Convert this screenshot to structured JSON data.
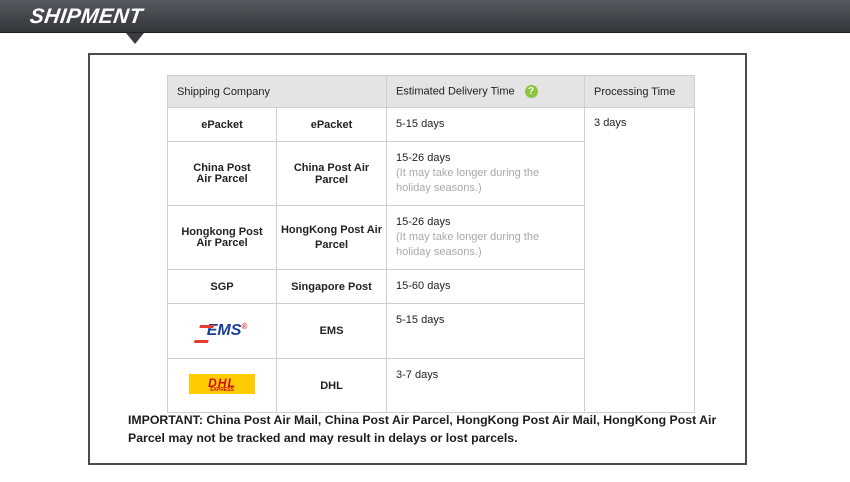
{
  "header": {
    "title": "SHIPMENT"
  },
  "table": {
    "headers": {
      "company": "Shipping Company",
      "delivery": "Estimated Delivery Time",
      "processing": "Processing Time"
    },
    "help_icon": "?",
    "processing_time": "3 days",
    "rows": [
      {
        "logo": "ePacket",
        "name": "ePacket",
        "time": "5-15 days",
        "note": ""
      },
      {
        "logo": "China Post\nAir Parcel",
        "name": "China Post Air Parcel",
        "time": "15-26 days",
        "note": "(It may take longer during the holiday seasons.)"
      },
      {
        "logo": "Hongkong Post\nAir Parcel",
        "name": "HongKong Post Air Parcel",
        "time": "15-26 days",
        "note": "(It may take longer during the holiday seasons.)"
      },
      {
        "logo": "SGP",
        "name": "Singapore Post",
        "time": "15-60 days",
        "note": ""
      },
      {
        "logo": "EMS",
        "name": "EMS",
        "time": "5-15 days",
        "note": ""
      },
      {
        "logo": "DHL",
        "name": "DHL",
        "time": "3-7 days",
        "note": ""
      }
    ],
    "logos": {
      "ems_text": "EMS",
      "ems_mark": "®",
      "dhl_text": "DHL",
      "dhl_sub": "EXPRESS"
    }
  },
  "important_text": "IMPORTANT: China Post Air Mail, China Post Air Parcel, HongKong Post Air Mail, HongKong Post Air Parcel may not be tracked and may result in delays or lost parcels.",
  "colors": {
    "header_bg": "#3a3d42",
    "help_icon": "#8cc63f",
    "ems_blue": "#1a3f96",
    "dhl_yellow": "#ffcc00",
    "dhl_red": "#d40511"
  }
}
